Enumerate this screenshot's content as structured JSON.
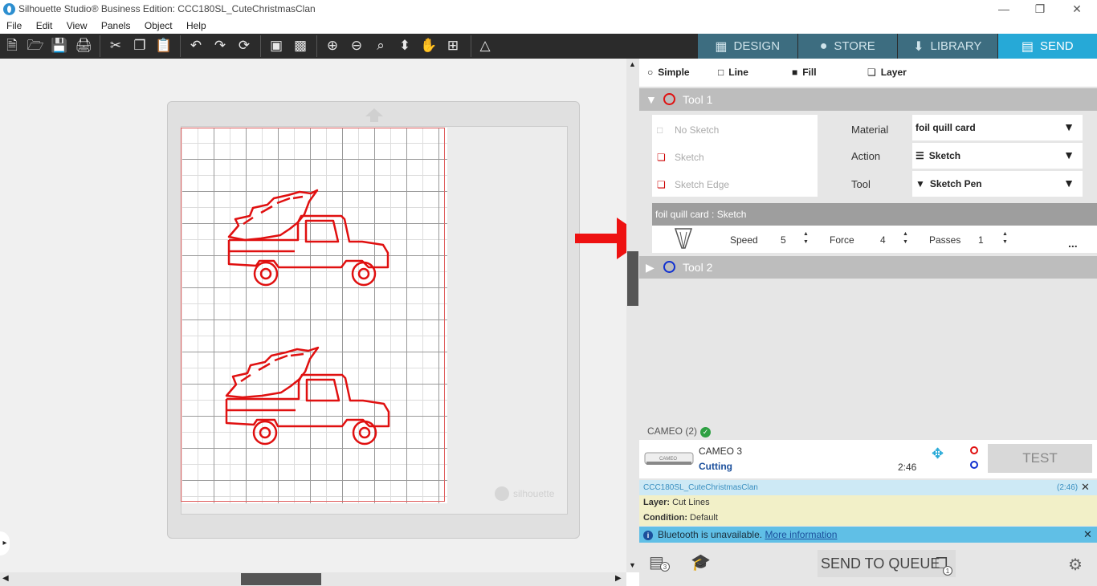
{
  "titlebar": {
    "title": "Silhouette Studio® Business Edition: CCC180SL_CuteChristmasClan",
    "minimize_icon": "minimize-icon",
    "restore_icon": "restore-icon",
    "close_icon": "close-icon"
  },
  "menu": [
    "File",
    "Edit",
    "View",
    "Panels",
    "Object",
    "Help"
  ],
  "toolbar_icons": [
    "new-icon",
    "open-icon",
    "save-icon",
    "print-icon",
    "cut-icon",
    "copy-icon",
    "paste-icon",
    "undo-icon",
    "redo-icon",
    "redraw-icon",
    "group-icon",
    "ungroup-icon",
    "zoom-in-icon",
    "zoom-out-icon",
    "zoom-select-icon",
    "move-icon",
    "pan-icon",
    "fit-icon",
    "pattern-icon"
  ],
  "tabs": [
    {
      "label": "DESIGN",
      "icon": "grid-icon",
      "active": false
    },
    {
      "label": "STORE",
      "icon": "silhouette-icon",
      "active": false
    },
    {
      "label": "LIBRARY",
      "icon": "download-icon",
      "active": false
    },
    {
      "label": "SEND",
      "icon": "cutter-icon",
      "active": true
    }
  ],
  "canvas": {
    "watermark": "silhouette",
    "cut_color": "#e01010"
  },
  "send_panel": {
    "modes": [
      "Simple",
      "Line",
      "Fill",
      "Layer"
    ],
    "tool1": {
      "label": "Tool 1",
      "color": "#e01010",
      "sketch_options": [
        "No Sketch",
        "Sketch",
        "Sketch Edge"
      ],
      "material_label": "Material",
      "material_value": "foil quill card",
      "action_label": "Action",
      "action_value": "Sketch",
      "tool_label": "Tool",
      "tool_value": "Sketch Pen",
      "summary": "foil quill card : Sketch",
      "speed_label": "Speed",
      "speed_value": "5",
      "force_label": "Force",
      "force_value": "4",
      "passes_label": "Passes",
      "passes_value": "1",
      "more": "..."
    },
    "tool2": {
      "label": "Tool 2",
      "color": "#1030d0"
    },
    "device_header": "CAMEO (2)",
    "device": {
      "name": "CAMEO 3",
      "status": "Cutting",
      "time": "2:46",
      "test_label": "TEST",
      "image_caption": "CAMEO"
    },
    "job": {
      "name": "CCC180SL_CuteChristmasClan",
      "time": "(2:46)",
      "layer_label": "Layer:",
      "layer_value": "Cut Lines",
      "condition_label": "Condition:",
      "condition_value": "Default"
    },
    "bluetooth": {
      "message": "Bluetooth is unavailable.",
      "link": "More information"
    },
    "queue_count": "3",
    "send_label": "SEND TO QUEUE",
    "send_badge": "1"
  }
}
